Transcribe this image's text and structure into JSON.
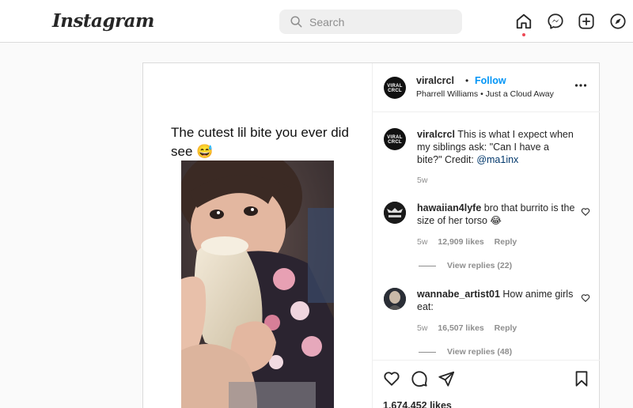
{
  "header": {
    "logo": "Instagram",
    "search_placeholder": "Search",
    "icons": [
      "home-icon",
      "messenger-icon",
      "new-post-icon",
      "explore-icon"
    ]
  },
  "post": {
    "caption_overlay": "The cutest lil bite you ever did see 😅",
    "author": {
      "username": "viralcrcl",
      "avatar_text": "VIRAL CRCL",
      "separator": "•",
      "follow_label": "Follow",
      "audio": "Pharrell Williams • Just a Cloud Away"
    },
    "caption": {
      "username": "viralcrcl",
      "text": "This is what I expect when my siblings ask: \"Can I have a bite?\" Credit: ",
      "credit": "@ma1inx",
      "time": "5w"
    },
    "comments": [
      {
        "username": "hawaiian4lyfe",
        "text": "bro that burrito is the size of her torso 😂",
        "time": "5w",
        "likes": "12,909 likes",
        "reply_label": "Reply",
        "view_replies": "View replies (22)"
      },
      {
        "username": "wannabe_artist01",
        "text": "How anime girls eat:",
        "time": "5w",
        "likes": "16,507 likes",
        "reply_label": "Reply",
        "view_replies": "View replies (48)"
      }
    ],
    "likes_total": "1,674,452 likes"
  },
  "colors": {
    "accent": "#0095f6",
    "notification_dot": "#ed4956",
    "border": "#dbdbdb",
    "background": "#fafafa"
  }
}
